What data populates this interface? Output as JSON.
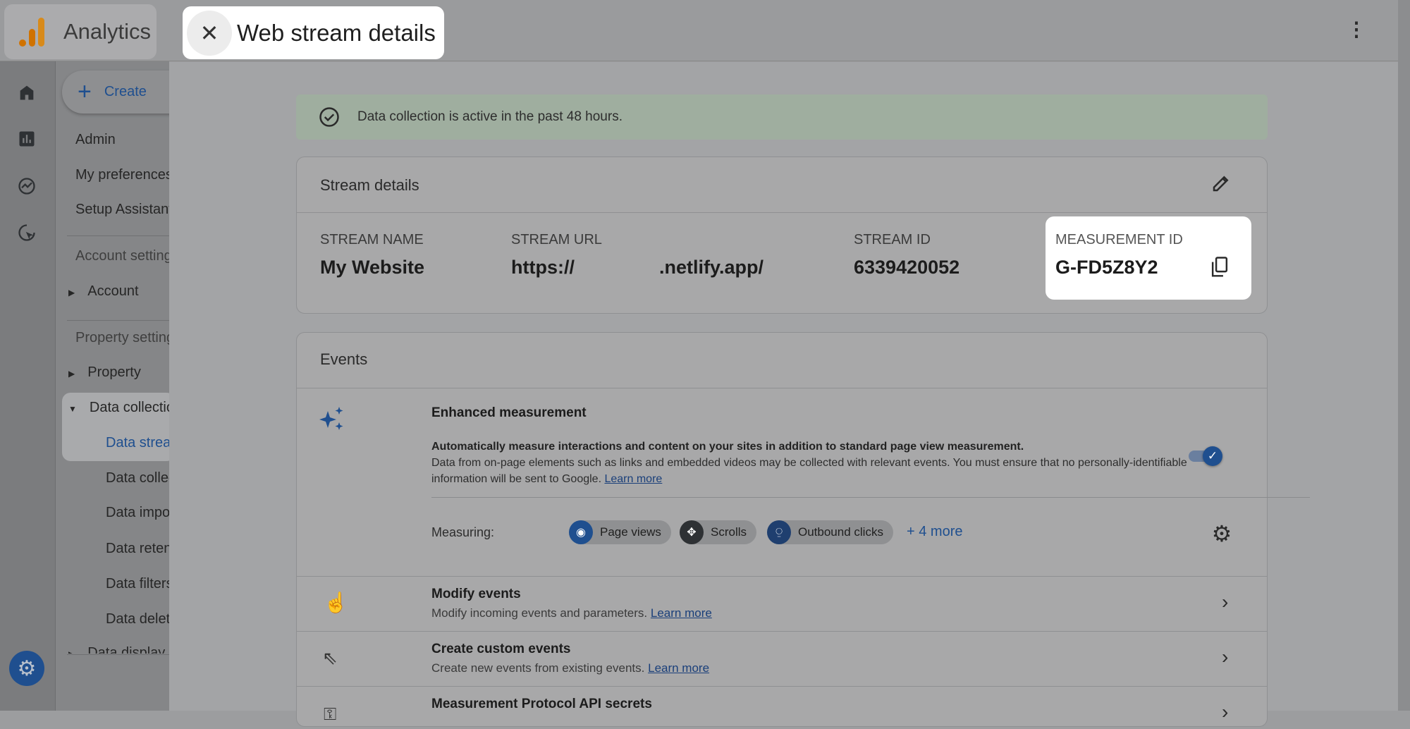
{
  "app": {
    "name": "Analytics",
    "brand_color": "#e37400"
  },
  "header": {
    "title": "Web stream details",
    "close_icon": "close-icon",
    "more_icon": "more-vert-icon"
  },
  "rail": {
    "icons": [
      "home-icon",
      "reports-icon",
      "explore-icon",
      "advertising-icon"
    ],
    "settings_icon": "gear-icon"
  },
  "sidebar": {
    "create_label": "Create",
    "items": [
      "Admin",
      "My preferences",
      "Setup Assistant"
    ],
    "account_settings": "Account settings",
    "account": "Account",
    "property_settings": "Property settings",
    "property": "Property",
    "data_collection": "Data collection and modification",
    "sub_items": [
      "Data streams",
      "Data collection",
      "Data import",
      "Data retention",
      "Data filters",
      "Data deletion requests"
    ],
    "data_display": "Data display"
  },
  "banner": {
    "text": "Data collection is active in the past 48 hours.",
    "status_color": "#9fae9f"
  },
  "stream": {
    "title": "Stream details",
    "name_label": "STREAM NAME",
    "name": "My Website",
    "url_label": "STREAM URL",
    "url_prefix": "https://",
    "url_suffix": ".netlify.app/",
    "id_label": "STREAM ID",
    "id": "6339420052",
    "mid_label": "MEASUREMENT ID",
    "mid": "G-FD5Z8Y2"
  },
  "events": {
    "title": "Events",
    "enhanced": {
      "title": "Enhanced measurement",
      "desc_bold": "Automatically measure interactions and content on your sites in addition to standard page view measurement.",
      "desc": "Data from on-page elements such as links and embedded videos may be collected with relevant events. You must ensure that no personally-identifiable information will be sent to Google.",
      "learn_more": "Learn more",
      "enabled": true,
      "measuring_label": "Measuring:",
      "chips": [
        {
          "label": "Page views",
          "icon": "eye-icon"
        },
        {
          "label": "Scrolls",
          "icon": "scroll-icon"
        },
        {
          "label": "Outbound clicks",
          "icon": "mouse-icon"
        }
      ],
      "more": "+ 4 more"
    },
    "rows": [
      {
        "title": "Modify events",
        "sub": "Modify incoming events and parameters.",
        "link": "Learn more",
        "icon": "touch-icon"
      },
      {
        "title": "Create custom events",
        "sub": "Create new events from existing events.",
        "link": "Learn more",
        "icon": "cursor-sparkle-icon"
      },
      {
        "title": "Measurement Protocol API secrets",
        "icon": "key-icon"
      }
    ]
  }
}
